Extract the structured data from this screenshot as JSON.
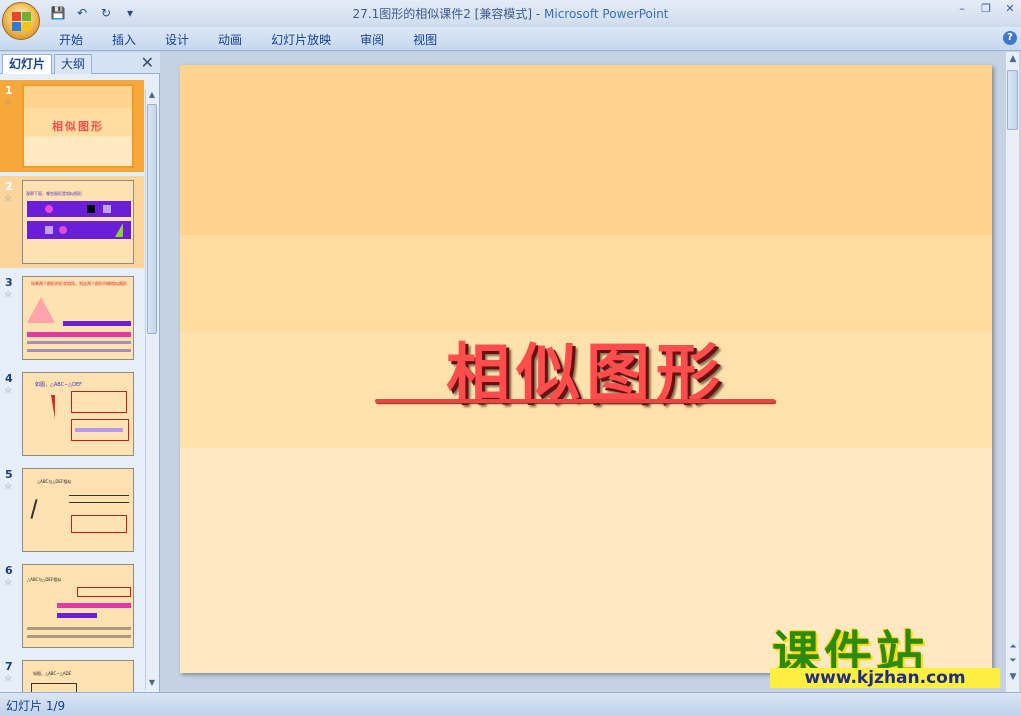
{
  "window": {
    "doc_title": "27.1图形的相似课件2 [兼容模式]",
    "separator": " - ",
    "app_name": "Microsoft PowerPoint"
  },
  "qat": {
    "save_icon": "💾",
    "undo_icon": "↶",
    "redo_icon": "↻",
    "more_icon": "▾"
  },
  "window_controls": {
    "minimize": "–",
    "restore": "❐",
    "close": "✕"
  },
  "ribbon": {
    "tabs": [
      "开始",
      "插入",
      "设计",
      "动画",
      "幻灯片放映",
      "审阅",
      "视图"
    ],
    "help": "?"
  },
  "left_pane": {
    "tab_slides": "幻灯片",
    "tab_outline": "大纲",
    "close": "✕",
    "slides": [
      {
        "num": "1",
        "star": "☆",
        "text": "相似图形"
      },
      {
        "num": "2",
        "star": "☆",
        "text": "观察下面，哪些图形是相似图形"
      },
      {
        "num": "3",
        "star": "☆",
        "text": "如果两个图形的形状相同，则这两个图形叫做相似图形"
      },
      {
        "num": "4",
        "star": "☆",
        "text": "如图，△ABC∽△DEF"
      },
      {
        "num": "5",
        "star": "☆",
        "text": "△ABC与△DEF相似"
      },
      {
        "num": "6",
        "star": "☆",
        "text": "△ABC与△DEF相似"
      },
      {
        "num": "7",
        "star": "☆",
        "text": "如图，△ABC∽△ADE"
      }
    ]
  },
  "slide": {
    "title": "相似图形"
  },
  "watermark": {
    "brand": "课件站",
    "url": "www.kjzhan.com"
  },
  "status": {
    "text": "幻灯片 1/9"
  },
  "colors": {
    "title_red": "#ff4d4d",
    "selection": "#f6a83b",
    "ribbon": "#c6d7ee"
  }
}
